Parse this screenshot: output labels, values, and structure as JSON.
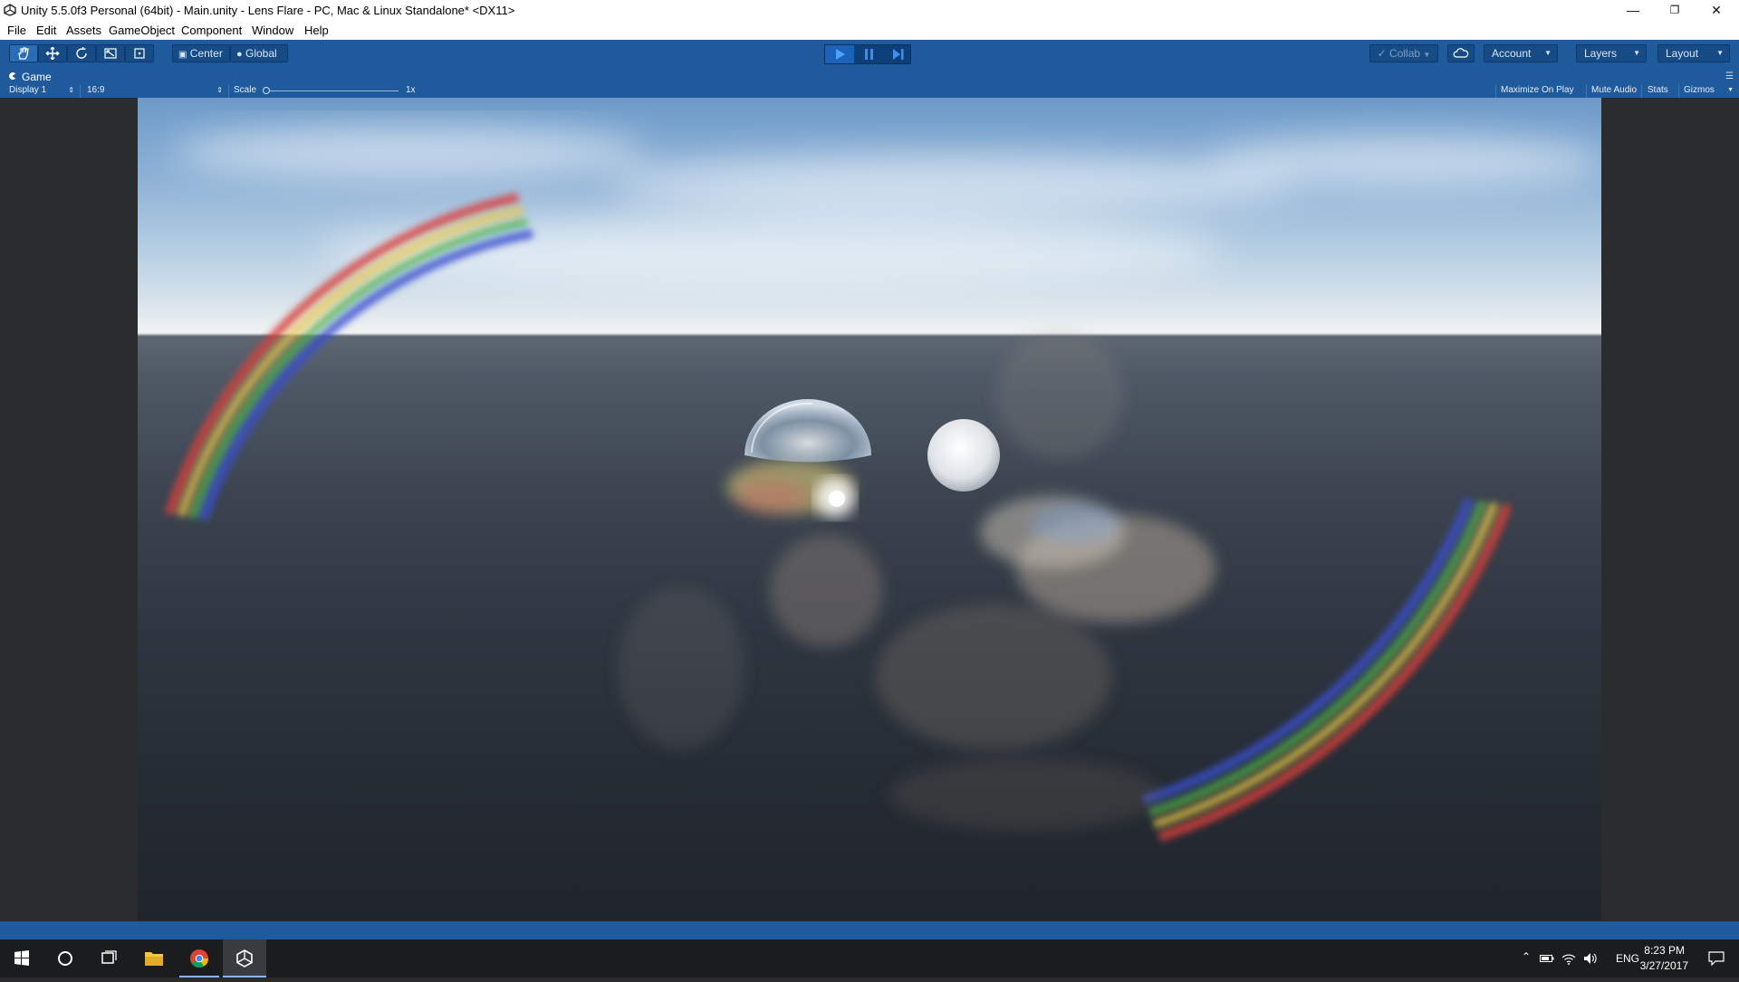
{
  "window": {
    "title": "Unity 5.5.0f3 Personal (64bit) - Main.unity - Lens Flare - PC, Mac & Linux Standalone* <DX11>",
    "controls": {
      "minimize": "—",
      "restore": "❐",
      "close": "✕"
    }
  },
  "menu": [
    "File",
    "Edit",
    "Assets",
    "GameObject",
    "Component",
    "Window",
    "Help"
  ],
  "toolbar": {
    "tools": [
      "hand-icon",
      "move-icon",
      "rotate-icon",
      "scale-icon",
      "rect-icon"
    ],
    "pivot_label": "Center",
    "space_label": "Global",
    "collab_label": "Collab",
    "account_label": "Account",
    "layers_label": "Layers",
    "layout_label": "Layout"
  },
  "game_tab": {
    "label": "Game",
    "display": "Display 1",
    "aspect": "16:9",
    "scale_label": "Scale",
    "scale_value": "1x",
    "scale_fraction": 0.0,
    "options": [
      "Maximize On Play",
      "Mute Audio",
      "Stats",
      "Gizmos"
    ]
  },
  "taskbar": {
    "language": "ENG",
    "time": "8:23 PM",
    "date": "3/27/2017"
  },
  "colors": {
    "accent": "#1f5a9c",
    "taskbar": "#1b1c1e",
    "sky_top": "#6d9ac9",
    "ground": "#2f3641"
  }
}
